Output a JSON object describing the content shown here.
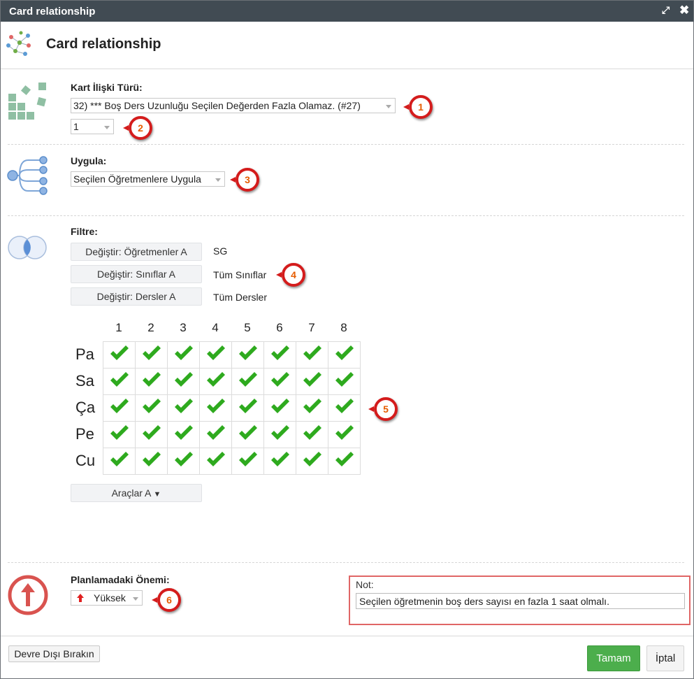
{
  "window": {
    "title": "Card relationship",
    "maximize_icon": "expand-icon",
    "close_icon": "close-icon"
  },
  "header": {
    "title": "Card relationship",
    "icon": "network-graph-icon"
  },
  "relation_type": {
    "label": "Kart İlişki Türü:",
    "selected": "32) *** Boş Ders Uzunluğu Seçilen Değerden Fazla Olamaz. (#27)",
    "value_selected": "1",
    "icon": "blocks-icon"
  },
  "apply": {
    "label": "Uygula:",
    "selected": "Seçilen Öğretmenlere Uygula",
    "icon": "tree-branch-icon"
  },
  "filter": {
    "label": "Filtre:",
    "icon": "venn-diagram-icon",
    "rows": [
      {
        "button": "Değiştir: Öğretmenler A",
        "value": "SG"
      },
      {
        "button": "Değiştir: Sınıflar A",
        "value": "Tüm Sınıflar"
      },
      {
        "button": "Değiştir: Dersler A",
        "value": "Tüm Dersler"
      }
    ]
  },
  "grid": {
    "columns": [
      "1",
      "2",
      "3",
      "4",
      "5",
      "6",
      "7",
      "8"
    ],
    "rows": [
      "Pa",
      "Sa",
      "Ça",
      "Pe",
      "Cu"
    ],
    "cell_icon": "checkmark-icon",
    "all_checked": true,
    "check_color": "#2eaa1e"
  },
  "tools_button": {
    "label": "Araçlar A",
    "arrow": "▼"
  },
  "importance": {
    "label": "Planlamadaki Önemi:",
    "selected": "Yüksek",
    "icon": "arrow-up-circle-icon"
  },
  "note": {
    "label": "Not:",
    "value": "Seçilen öğretmenin boş ders sayısı en fazla 1 saat olmalı."
  },
  "footer": {
    "disable_label": "Devre Dışı Bırakın",
    "ok_label": "Tamam",
    "cancel_label": "İptal"
  },
  "callouts": [
    "1",
    "2",
    "3",
    "4",
    "5",
    "6"
  ],
  "colors": {
    "titlebar": "#414b53",
    "accent_green": "#4cae4c",
    "callout_red": "#d41c1c",
    "callout_number": "#e65c00",
    "note_border": "#e06666"
  }
}
